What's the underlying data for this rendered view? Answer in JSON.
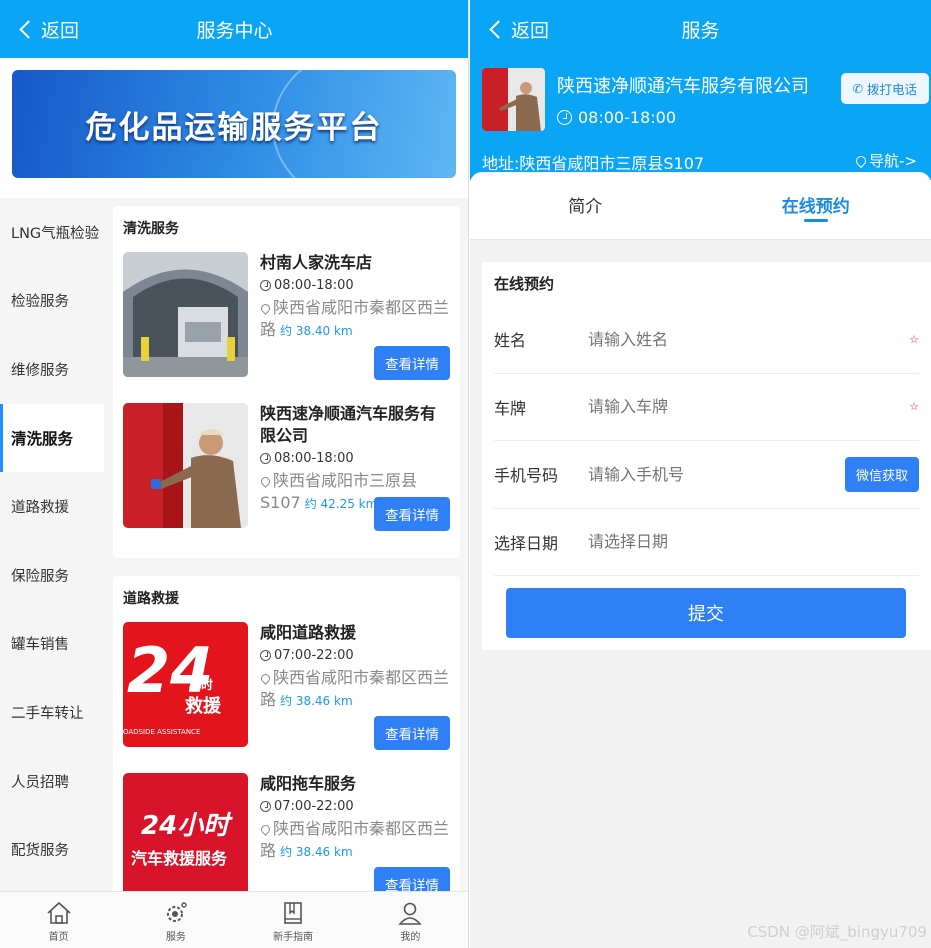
{
  "left": {
    "back_label": "返回",
    "title": "服务中心",
    "banner_text": "危化品运输服务平台",
    "sidebar": [
      {
        "label": "LNG气瓶检验"
      },
      {
        "label": "检验服务"
      },
      {
        "label": "维修服务"
      },
      {
        "label": "清洗服务",
        "active": true
      },
      {
        "label": "道路救援"
      },
      {
        "label": "保险服务"
      },
      {
        "label": "罐车销售"
      },
      {
        "label": "二手车转让"
      },
      {
        "label": "人员招聘"
      },
      {
        "label": "配货服务"
      }
    ],
    "sections": [
      {
        "title": "清洗服务",
        "items": [
          {
            "name": "村南人家洗车店",
            "hours": "08:00-18:00",
            "address": "陕西省咸阳市秦都区西兰路",
            "distance": "约 38.40 km",
            "button": "查看详情"
          },
          {
            "name": "陕西速净顺通汽车服务有限公司",
            "hours": "08:00-18:00",
            "address": "陕西省咸阳市三原县S107",
            "distance": "约 42.25 km",
            "button": "查看详情"
          }
        ]
      },
      {
        "title": "道路救援",
        "items": [
          {
            "name": "咸阳道路救援",
            "hours": "07:00-22:00",
            "address": "陕西省咸阳市秦都区西兰路",
            "distance": "约 38.46 km",
            "button": "查看详情"
          },
          {
            "name": "咸阳拖车服务",
            "hours": "07:00-22:00",
            "address": "陕西省咸阳市秦都区西兰路",
            "distance": "约 38.46 km",
            "button": "查看详情"
          }
        ]
      }
    ],
    "thumb_text": {
      "rescue_24": "24",
      "rescue_hours": "小时",
      "rescue_word": "救援",
      "rescue_en": "OADSIDE ASSISTANCE",
      "tow_line1": "24小时",
      "tow_line2": "汽车救援服务"
    },
    "tabbar": [
      {
        "label": "首页",
        "icon": "home-icon"
      },
      {
        "label": "服务",
        "icon": "service-gear-icon"
      },
      {
        "label": "新手指南",
        "icon": "book-icon"
      },
      {
        "label": "我的",
        "icon": "user-icon"
      }
    ]
  },
  "right": {
    "back_label": "返回",
    "title": "服务",
    "company": {
      "name": "陕西速净顺通汽车服务有限公司",
      "hours": "08:00-18:00",
      "call_label": "拨打电话",
      "address": "地址:陕西省咸阳市三原县S107",
      "nav_label": "导航->"
    },
    "tabs": [
      {
        "label": "简介",
        "active": false
      },
      {
        "label": "在线预约",
        "active": true
      }
    ],
    "form": {
      "title": "在线预约",
      "fields": [
        {
          "label": "姓名",
          "placeholder": "请输入姓名",
          "required": "☆"
        },
        {
          "label": "车牌",
          "placeholder": "请输入车牌",
          "required": "☆"
        },
        {
          "label": "手机号码",
          "placeholder": "请输入手机号",
          "action": "微信获取"
        },
        {
          "label": "选择日期",
          "placeholder": "请选择日期"
        }
      ],
      "submit": "提交"
    },
    "watermark": "CSDN @阿斌_bingyu709"
  },
  "colors": {
    "primary": "#0aa6f5",
    "button": "#2f7ff5",
    "accent": "#1a8be0"
  }
}
